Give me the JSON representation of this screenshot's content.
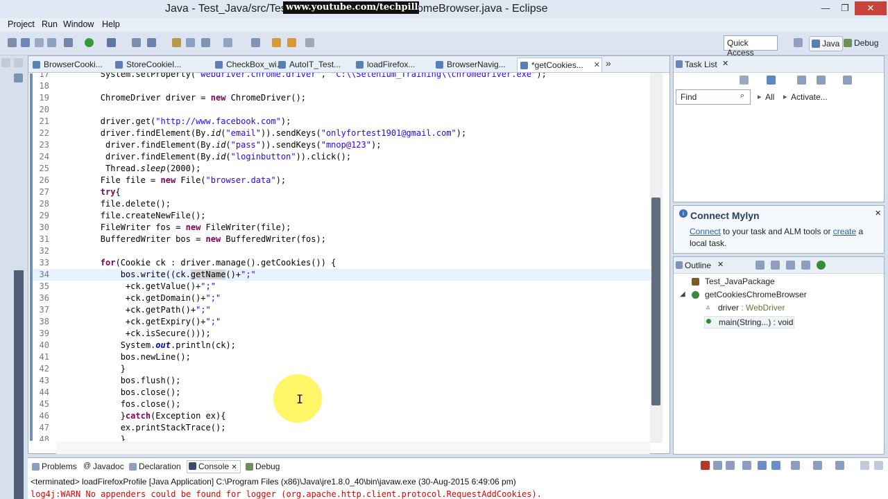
{
  "window": {
    "title_part1": "Java - Test_Java/src/Test_",
    "title_part2": "omeBrowser.java - Eclipse",
    "watermark": "www.youtube.com/techpills",
    "minimize": "—",
    "maximize": "❐",
    "close": "✕"
  },
  "menu": {
    "items": [
      "Project",
      "Run",
      "Window",
      "Help"
    ]
  },
  "toolbar": {
    "quick_access": "Quick Access",
    "perspectives": [
      {
        "label": "Java",
        "active": true
      },
      {
        "label": "Debug",
        "active": false
      }
    ]
  },
  "editor": {
    "tabs": [
      {
        "label": "BrowserCooki...",
        "active": false
      },
      {
        "label": "StoreCookieI...",
        "active": false
      },
      {
        "label": "CheckBox_wi...",
        "active": false
      },
      {
        "label": "AutoIT_Test...",
        "active": false
      },
      {
        "label": "loadFirefox...",
        "active": false
      },
      {
        "label": "BrowserNavig...",
        "active": false
      },
      {
        "label": "*getCookies...",
        "active": true
      }
    ],
    "overflow_label": "»",
    "lines": [
      {
        "num": "17",
        "text": "        System.setProperty(\"webdriver.chrome.driver\", \"C:\\\\Selenium_Training\\\\chromedriver.exe\");"
      },
      {
        "num": "18",
        "text": ""
      },
      {
        "num": "19",
        "text": "        ChromeDriver driver = new ChromeDriver();"
      },
      {
        "num": "20",
        "text": ""
      },
      {
        "num": "21",
        "text": "        driver.get(\"http://www.facebook.com\");"
      },
      {
        "num": "22",
        "text": "        driver.findElement(By.id(\"email\")).sendKeys(\"onlyfortest1901@gmail.com\");"
      },
      {
        "num": "23",
        "text": "         driver.findElement(By.id(\"pass\")).sendKeys(\"mnop@123\");"
      },
      {
        "num": "24",
        "text": "         driver.findElement(By.id(\"loginbutton\")).click();"
      },
      {
        "num": "25",
        "text": "         Thread.sleep(2000);"
      },
      {
        "num": "26",
        "text": "        File file = new File(\"browser.data\");"
      },
      {
        "num": "27",
        "text": "        try{"
      },
      {
        "num": "28",
        "text": "        file.delete();"
      },
      {
        "num": "29",
        "text": "        file.createNewFile();"
      },
      {
        "num": "30",
        "text": "        FileWriter fos = new FileWriter(file);"
      },
      {
        "num": "31",
        "text": "        BufferedWriter bos = new BufferedWriter(fos);"
      },
      {
        "num": "32",
        "text": ""
      },
      {
        "num": "33",
        "text": "        for(Cookie ck : driver.manage().getCookies()) {"
      },
      {
        "num": "34",
        "text": "            bos.write((ck.getName()+\";\"",
        "highlight": true
      },
      {
        "num": "35",
        "text": "             +ck.getValue()+\";\""
      },
      {
        "num": "36",
        "text": "             +ck.getDomain()+\";\""
      },
      {
        "num": "37",
        "text": "             +ck.getPath()+\";\""
      },
      {
        "num": "38",
        "text": "             +ck.getExpiry()+\";\""
      },
      {
        "num": "39",
        "text": "             +ck.isSecure()));"
      },
      {
        "num": "40",
        "text": "            System.out.println(ck);"
      },
      {
        "num": "41",
        "text": "            bos.newLine();"
      },
      {
        "num": "42",
        "text": "            }"
      },
      {
        "num": "43",
        "text": "            bos.flush();"
      },
      {
        "num": "44",
        "text": "            bos.close();"
      },
      {
        "num": "45",
        "text": "            fos.close();"
      },
      {
        "num": "46",
        "text": "            }catch(Exception ex){"
      },
      {
        "num": "47",
        "text": "            ex.printStackTrace();"
      },
      {
        "num": "48",
        "text": "            }"
      }
    ]
  },
  "task_list": {
    "title": "Task List",
    "find_placeholder": "Find",
    "all_label": "All",
    "activate_label": "Activate..."
  },
  "mylyn": {
    "title": "Connect Mylyn",
    "connect_link": "Connect",
    "middle_text": " to your task and ALM tools or ",
    "create_link": "create",
    "end_text": " a local task."
  },
  "outline": {
    "title": "Outline",
    "package": "Test_JavaPackage",
    "class_name": "getCookiesChromeBrowser",
    "field_name": "driver",
    "field_type": " : WebDriver",
    "method": "main(String...) : void"
  },
  "console": {
    "tabs": [
      {
        "label": "Problems",
        "active": false
      },
      {
        "label": "Javadoc",
        "active": false
      },
      {
        "label": "Declaration",
        "active": false
      },
      {
        "label": "Console",
        "active": true
      },
      {
        "label": "Debug",
        "active": false
      }
    ],
    "terminated": "<terminated> loadFirefoxProfile [Java Application] C:\\Program Files (x86)\\Java\\jre1.8.0_40\\bin\\javaw.exe (30-Aug-2015 6:49:06 pm)",
    "warning": "log4j:WARN No appenders could be found for logger (org.apache.http.client.protocol.RequestAddCookies)."
  },
  "colors": {
    "keyword": "#7f0055",
    "string": "#2a00ff",
    "field": "#0000c0",
    "console_error": "#e00000",
    "link": "#2b5bb8"
  }
}
